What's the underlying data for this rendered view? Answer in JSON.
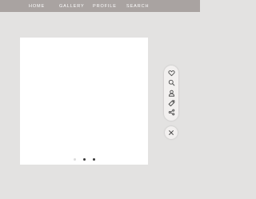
{
  "nav": {
    "items": [
      {
        "label": "HOME"
      },
      {
        "label": "GALLERY"
      },
      {
        "label": "PROFILE"
      },
      {
        "label": "SEARCH"
      }
    ]
  },
  "carousel": {
    "dots": [
      "inactive",
      "active",
      "active"
    ]
  },
  "tools": {
    "icons": [
      "heart-icon",
      "search-icon",
      "user-icon",
      "tag-icon",
      "share-icon"
    ]
  },
  "close": {
    "icon": "close-icon"
  }
}
